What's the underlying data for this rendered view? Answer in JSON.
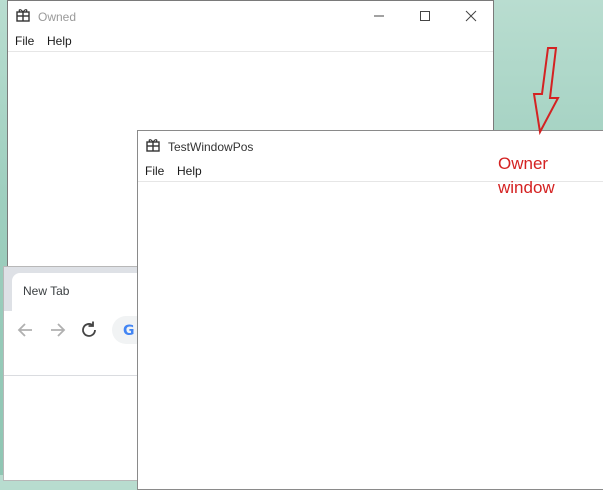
{
  "owned_window": {
    "title": "Owned",
    "menu": [
      "File",
      "Help"
    ],
    "icon": "gift-icon"
  },
  "browser_window": {
    "tab_label": "New Tab",
    "omnibox_logo": "G"
  },
  "owner_window": {
    "title": "TestWindowPos",
    "menu": [
      "File",
      "Help"
    ],
    "icon": "gift-icon"
  },
  "annotation": {
    "line1": "Owner",
    "line2": "window",
    "color": "#d42222"
  }
}
